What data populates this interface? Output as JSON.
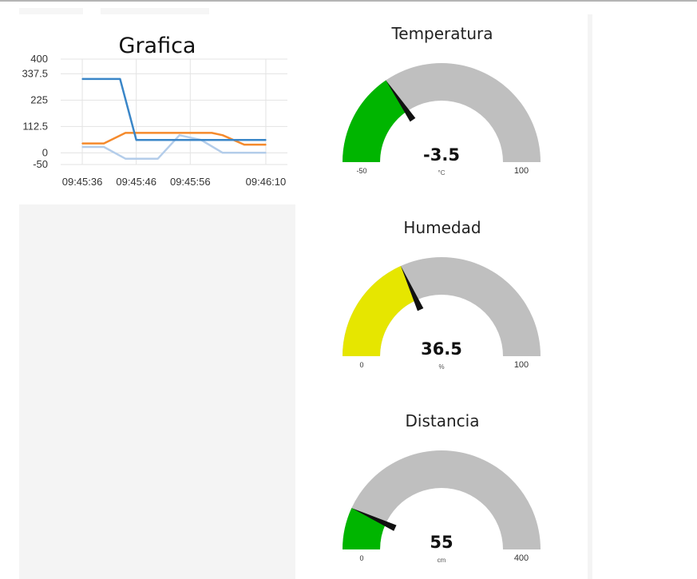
{
  "chart": {
    "title": "Grafica"
  },
  "chart_data": {
    "type": "line",
    "title": "Grafica",
    "xlabel": "",
    "ylabel": "",
    "x_ticks": [
      "09:45:36",
      "09:45:46",
      "09:45:56",
      "09:46:10"
    ],
    "y_ticks": [
      "400",
      "337.5",
      "225",
      "112.5",
      "0",
      "-50"
    ],
    "ylim": [
      -50,
      400
    ],
    "grid": true,
    "series": [
      {
        "color": "#3a86c8",
        "x": [
          "09:45:36",
          "09:45:43",
          "09:45:46",
          "09:45:56",
          "09:46:00",
          "09:46:06",
          "09:46:10"
        ],
        "values": [
          315,
          315,
          55,
          55,
          55,
          55,
          55
        ]
      },
      {
        "color": "#f58a2c",
        "x": [
          "09:45:36",
          "09:45:40",
          "09:45:44",
          "09:45:50",
          "09:45:56",
          "09:46:00",
          "09:46:02",
          "09:46:06",
          "09:46:10"
        ],
        "values": [
          40,
          40,
          85,
          85,
          85,
          85,
          75,
          35,
          35
        ]
      },
      {
        "color": "#b4cdea",
        "x": [
          "09:45:36",
          "09:45:40",
          "09:45:44",
          "09:45:50",
          "09:45:54",
          "09:45:58",
          "09:46:02",
          "09:46:06",
          "09:46:10"
        ],
        "values": [
          25,
          25,
          -25,
          -25,
          75,
          55,
          0,
          0,
          0
        ]
      }
    ]
  },
  "gauges": [
    {
      "title": "Temperatura",
      "value": -3.5,
      "value_text": "-3.5",
      "unit": "°C",
      "min": -50,
      "max": 100,
      "min_text": "-50",
      "max_text": "100",
      "color": "#00b500"
    },
    {
      "title": "Humedad",
      "value": 36.5,
      "value_text": "36.5",
      "unit": "%",
      "min": 0,
      "max": 100,
      "min_text": "0",
      "max_text": "100",
      "color": "#e6e600"
    },
    {
      "title": "Distancia",
      "value": 55,
      "value_text": "55",
      "unit": "cm",
      "min": 0,
      "max": 400,
      "min_text": "0",
      "max_text": "400",
      "color": "#00b500"
    }
  ],
  "colors": {
    "gauge_track": "#bfbfbf",
    "needle": "#111111",
    "grid": "#e3e3e3"
  }
}
